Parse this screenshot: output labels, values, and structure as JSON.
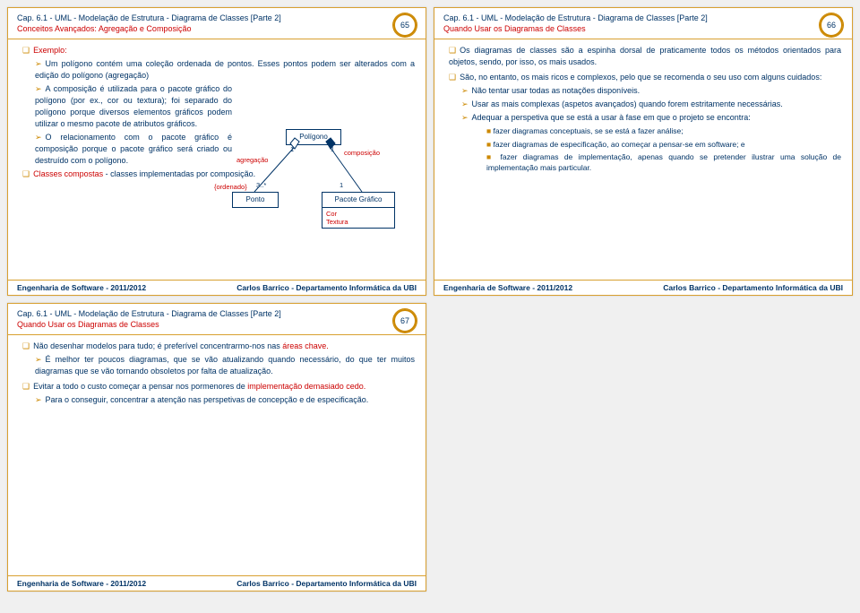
{
  "footer": {
    "left": "Engenharia de Software - 2011/2012",
    "right": "Carlos Barrico - Departamento Informática da UBI"
  },
  "s65": {
    "chapter": "Cap. 6.1 - UML - Modelação de Estrutura - Diagrama de Classes [Parte 2]",
    "subtitle": "Conceitos Avançados: Agregação e Composição",
    "page": "65",
    "h1": "Exemplo:",
    "p1a": "Um polígono contém uma coleção ordenada de pontos. Esses pontos podem ser alterados com a edição do polígono (agregação)",
    "p2": "A composição é utilizada para o pacote gráfico do polígono (por ex., cor ou textura); foi separado do polígono porque diversos elementos gráficos podem utilizar o mesmo pacote de atributos gráficos.",
    "p3": "O relacionamento com o pacote gráfico é composição porque o pacote gráfico será criado ou destruído com o polígono.",
    "p4a": "Classes compostas",
    "p4b": " - classes implementadas por composição.",
    "uml": {
      "poligono": "Polígono",
      "ponto": "Ponto",
      "pacote": "Pacote Gráfico",
      "agregacao": "agregação",
      "composicao": "composição",
      "ordenado": "{ordenado}",
      "mult1": "1",
      "mult3": "3..*",
      "attr1": "Cor",
      "attr2": "Textura"
    }
  },
  "s66": {
    "chapter": "Cap. 6.1 - UML - Modelação de Estrutura - Diagrama de Classes [Parte 2]",
    "subtitle": "Quando Usar os Diagramas de Classes",
    "page": "66",
    "p1": "Os diagramas de classes são a espinha dorsal de praticamente todos os métodos orientados para objetos, sendo, por isso, os mais usados.",
    "p2": "São, no entanto, os mais ricos e complexos, pelo que se recomenda o seu uso com alguns cuidados:",
    "b1": "Não tentar usar todas as notações disponíveis.",
    "b2": "Usar as mais complexas (aspetos avançados) quando forem estritamente necessárias.",
    "b3": "Adequar a perspetiva que se está a usar à fase em que o projeto se encontra:",
    "b3a": "fazer diagramas conceptuais, se se está a fazer análise;",
    "b3b": "fazer diagramas de especificação, ao começar a pensar-se em software; e",
    "b3c": "fazer diagramas de implementação, apenas quando se pretender ilustrar uma solução de implementação mais particular."
  },
  "s67": {
    "chapter": "Cap. 6.1 - UML - Modelação de Estrutura - Diagrama de Classes [Parte 2]",
    "subtitle": "Quando Usar os Diagramas de Classes",
    "page": "67",
    "p1a": "Não desenhar modelos para tudo; é preferível concentrarmo-nos nas ",
    "p1b": "áreas chave.",
    "b1": "É melhor ter poucos diagramas, que se vão atualizando quando necessário, do que ter muitos diagramas que se vão tornando obsoletos por falta de atualização.",
    "p2a": "Evitar a todo o custo começar a pensar nos pormenores de ",
    "p2b": "implementação demasiado cedo.",
    "b2": "Para o conseguir, concentrar a atenção nas perspetivas de concepção e de especificação."
  }
}
